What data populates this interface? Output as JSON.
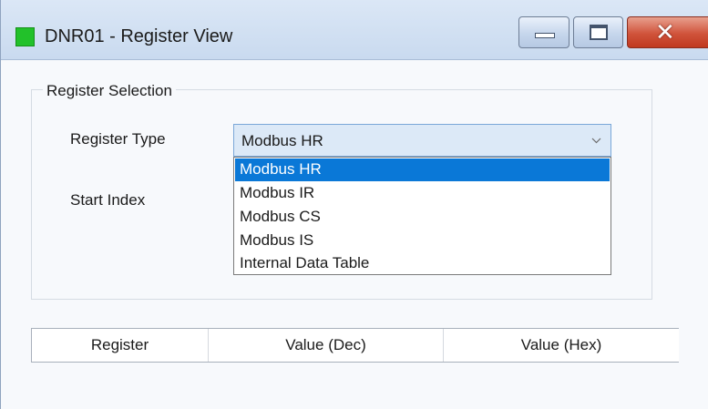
{
  "window": {
    "title": "DNR01 - Register View",
    "controls": {
      "minimize": "minimize",
      "maximize": "maximize",
      "close": "close"
    }
  },
  "register_selection": {
    "group_title": "Register Selection",
    "register_type_label": "Register Type",
    "start_index_label": "Start Index",
    "register_type": {
      "selected": "Modbus HR",
      "expanded": true,
      "options": [
        "Modbus HR",
        "Modbus IR",
        "Modbus CS",
        "Modbus IS",
        "Internal Data Table"
      ]
    }
  },
  "table": {
    "columns": [
      "Register",
      "Value (Dec)",
      "Value (Hex)"
    ]
  },
  "icons": {
    "app": "app-status-icon",
    "combo_arrow": "chevron-down-icon"
  },
  "colors": {
    "app_icon": "#22c12a",
    "selection": "#0a78d7",
    "close_button": "#c0391f"
  }
}
